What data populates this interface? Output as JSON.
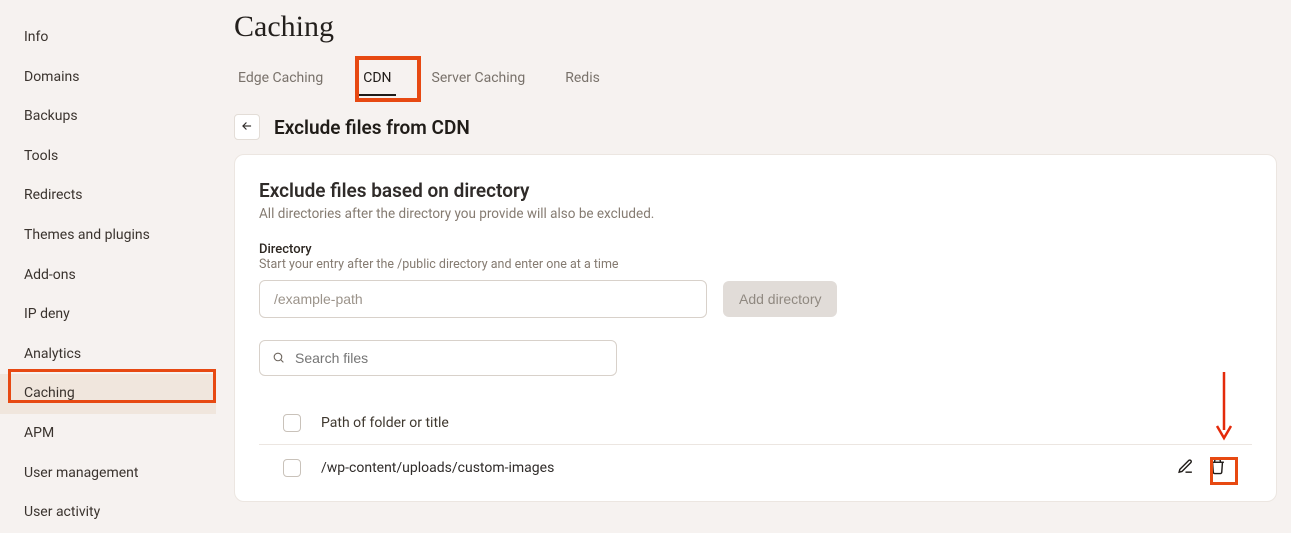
{
  "sidebar": {
    "items": [
      {
        "label": "Info"
      },
      {
        "label": "Domains"
      },
      {
        "label": "Backups"
      },
      {
        "label": "Tools"
      },
      {
        "label": "Redirects"
      },
      {
        "label": "Themes and plugins"
      },
      {
        "label": "Add-ons"
      },
      {
        "label": "IP deny"
      },
      {
        "label": "Analytics"
      },
      {
        "label": "Caching",
        "active": true
      },
      {
        "label": "APM"
      },
      {
        "label": "User management"
      },
      {
        "label": "User activity"
      }
    ]
  },
  "page": {
    "title": "Caching",
    "tabs": [
      {
        "label": "Edge Caching"
      },
      {
        "label": "CDN",
        "active": true
      },
      {
        "label": "Server Caching"
      },
      {
        "label": "Redis"
      }
    ],
    "subheading": "Exclude files from CDN"
  },
  "exclude_panel": {
    "heading": "Exclude files based on directory",
    "description": "All directories after the directory you provide will also be excluded.",
    "directory_label": "Directory",
    "directory_hint": "Start your entry after the /public directory and enter one at a time",
    "directory_placeholder": "/example-path",
    "add_button_label": "Add directory",
    "search_placeholder": "Search files",
    "list_header": "Path of folder or title",
    "rows": [
      {
        "path": "/wp-content/uploads/custom-images"
      }
    ]
  }
}
